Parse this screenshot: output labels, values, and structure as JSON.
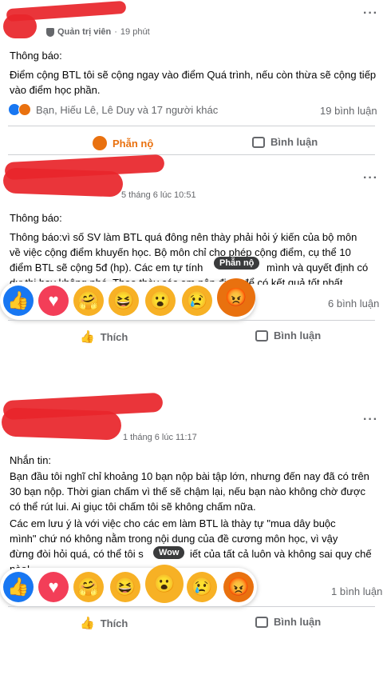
{
  "post1": {
    "badge": "Quản trị viên",
    "time": "19 phút",
    "heading": "Thông báo:",
    "body": "Điểm cộng BTL tôi sẽ cộng ngay vào điểm Quá trình, nếu còn thừa sẽ cộng tiếp vào điểm học phần.",
    "reactors": "Bạn, Hiếu Lê, Lê Duy và 17 người khác",
    "comments": "19 bình luận",
    "reaction_label": "Phẫn nộ",
    "comment_label": "Bình luận"
  },
  "post2": {
    "time": "5 tháng 6 lúc 10:51",
    "heading": "Thông báo:",
    "body_line1": "Thông báo:vì số SV làm BTL quá đông nên thày phải hỏi ý kiến của bộ môn",
    "body_line2": "về việc cộng điểm khuyến học. Bộ môn chỉ cho phép cộng điểm, cụ thể 10",
    "body_line3": "điểm BTL sẽ cộng 5đ (hp). Các em tự tính",
    "body_line3b": "mình và quyết định có",
    "body_line4": "dự thi hay không nhé. Theo thày các em nên đi thi để có kết quả tốt nhất.",
    "tooltip": "Phẫn nộ",
    "comments": "6 bình luận",
    "like_label": "Thích",
    "comment_label": "Bình luận"
  },
  "post3": {
    "time": "1 tháng 6 lúc 11:17",
    "heading": "Nhắn tin:",
    "para1": "Bạn đầu tôi nghĩ chỉ khoảng 10 bạn nộp bài tập lớn, nhưng đến nay đã có trên 30 bạn nộp. Thời gian chấm vì thế sẽ chậm lại, nếu bạn nào không chờ được có thể rút lui. Ai giục tôi chấm tôi sẽ không chấm nữa.",
    "para2_line1": "Các em lưu ý là với việc cho các em làm BTL là thày tự \"mua dây buộc",
    "para2_line2": "mình\" chứ nó không nằm trong nội dung của đề cương môn học, vì vậy",
    "para2_line3a": "đừng đòi hỏi quá, có thể tôi s",
    "para2_line3b": "iết của tất cả luôn và không sai quy chế",
    "para2_line4": "nào!",
    "tooltip": "Wow",
    "comments": "1 bình luận",
    "like_label": "Thích",
    "comment_label": "Bình luận"
  },
  "colors": {
    "angry": "#e9710f",
    "like": "#1877f2",
    "scribble": "#e8262b"
  }
}
